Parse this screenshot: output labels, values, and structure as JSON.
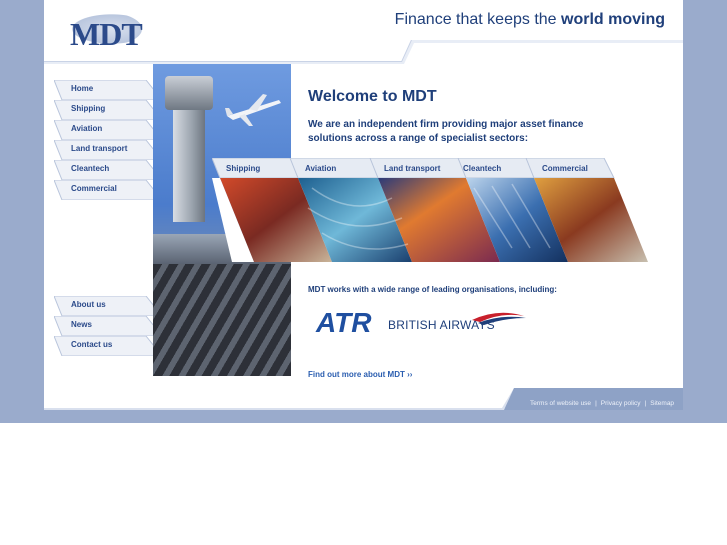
{
  "header": {
    "logo_text": "MDT",
    "tagline_prefix": "Finance that keeps the ",
    "tagline_bold": "world moving"
  },
  "nav": {
    "primary": [
      {
        "label": "Home"
      },
      {
        "label": "Shipping"
      },
      {
        "label": "Aviation"
      },
      {
        "label": "Land transport"
      },
      {
        "label": "Cleantech"
      },
      {
        "label": "Commercial"
      }
    ],
    "secondary": [
      {
        "label": "About us"
      },
      {
        "label": "News"
      },
      {
        "label": "Contact us"
      }
    ]
  },
  "main": {
    "title": "Welcome to MDT",
    "intro": "We are an independent firm providing major asset finance solutions across a range of specialist sectors:",
    "sectors": [
      {
        "label": "Shipping"
      },
      {
        "label": "Aviation"
      },
      {
        "label": "Land transport"
      },
      {
        "label": "Cleantech"
      },
      {
        "label": "Commercial"
      }
    ],
    "partners_heading": "MDT works with a wide range of leading organisations, including:",
    "partner_atr": "ATR",
    "partner_ba": "BRITISH AIRWAYS",
    "find_out_more": "Find out more about MDT ››"
  },
  "footer": {
    "links": [
      "Terms of website use",
      "Privacy policy",
      "Sitemap"
    ],
    "separator": "|"
  },
  "colors": {
    "brand_navy": "#1f3f7a",
    "link_blue": "#2b5eb0",
    "page_band": "#9aabcc"
  }
}
